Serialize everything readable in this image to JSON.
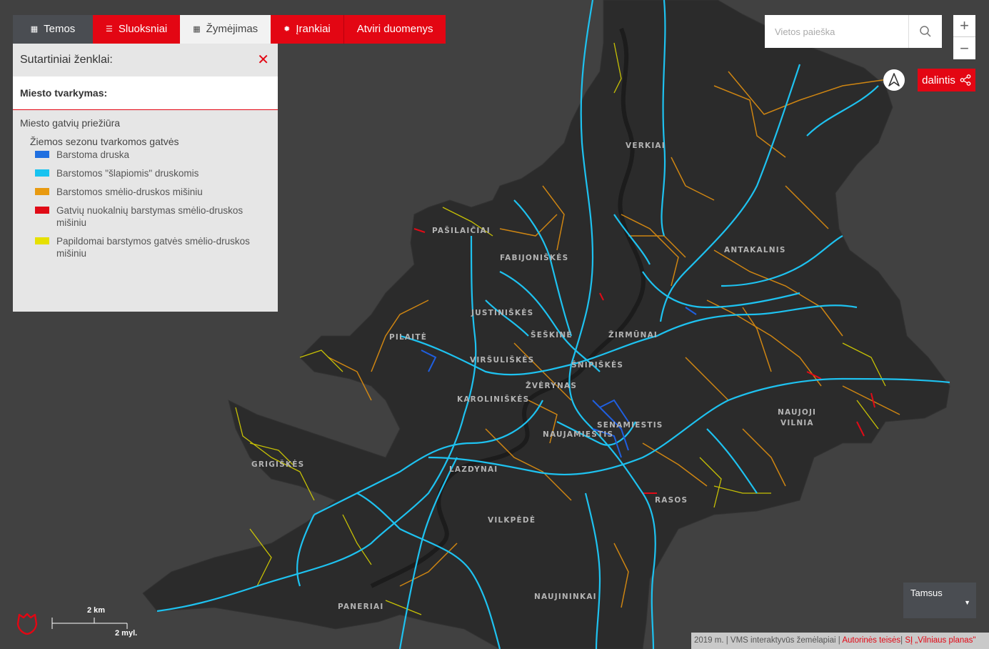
{
  "tabs": [
    {
      "label": "Temos",
      "icon": "grid-icon"
    },
    {
      "label": "Sluoksniai",
      "icon": "list-icon"
    },
    {
      "label": "Žymėjimas",
      "icon": "grid-icon"
    },
    {
      "label": "Įrankiai",
      "icon": "gear-icon"
    },
    {
      "label": "Atviri duomenys"
    }
  ],
  "legend": {
    "title": "Sutartiniai ženklai:",
    "section": "Miesto tvarkymas:",
    "group": "Miesto gatvių priežiūra",
    "subgroup": "Žiemos sezonu tvarkomos gatvės",
    "items": [
      {
        "label": "Barstoma druska",
        "color": "#1f6fe0"
      },
      {
        "label": "Barstomos \"šlapiomis\" druskomis",
        "color": "#18c3f0"
      },
      {
        "label": "Barstomos smėlio-druskos mišiniu",
        "color": "#e89a10"
      },
      {
        "label": "Gatvių nuokalnių barstymas smėlio-druskos mišiniu",
        "color": "#e00b17"
      },
      {
        "label": "Papildomai barstymos gatvės smėlio-druskos mišiniu",
        "color": "#e6e000"
      }
    ]
  },
  "search": {
    "placeholder": "Vietos paieška"
  },
  "zoom": {
    "plus": "+",
    "minus": "−"
  },
  "share": {
    "label": "dalintis"
  },
  "basemap": {
    "selected": "Tamsus"
  },
  "scale": {
    "km": "2 km",
    "mi": "2 myl."
  },
  "attribution": {
    "text": "2019 m. | VMS interaktyvūs žemėlapiai | ",
    "link1": "Autorinės teisės",
    "sep": "| ",
    "link2": "SĮ „Vilniaus planas\""
  },
  "districts": [
    {
      "name": "VERKIAI"
    },
    {
      "name": "ANTAKALNIS"
    },
    {
      "name": "PAŠILAIČIAI"
    },
    {
      "name": "FABIJONIŠKĖS"
    },
    {
      "name": "JUSTINIŠKĖS"
    },
    {
      "name": "PILAITĖ"
    },
    {
      "name": "ŠEŠKINĖ"
    },
    {
      "name": "ŽIRMŪNAI"
    },
    {
      "name": "VIRŠULIŠKĖS"
    },
    {
      "name": "ŠNIPIŠKĖS"
    },
    {
      "name": "ŽVĖRYNAS"
    },
    {
      "name": "KAROLINIŠKĖS"
    },
    {
      "name": "SENAMIESTIS"
    },
    {
      "name": "NAUJAMIESTIS"
    },
    {
      "name": "NAUJOJI"
    },
    {
      "name": "VILNIA"
    },
    {
      "name": "GRIGIŠKĖS"
    },
    {
      "name": "LAZDYNAI"
    },
    {
      "name": "RASOS"
    },
    {
      "name": "VILKPĖDĖ"
    },
    {
      "name": "NAUJININKAI"
    },
    {
      "name": "PANERIAI"
    }
  ],
  "colors": {
    "accent": "#e30613",
    "map_bg": "#414141",
    "city": "#2c2c2c"
  }
}
